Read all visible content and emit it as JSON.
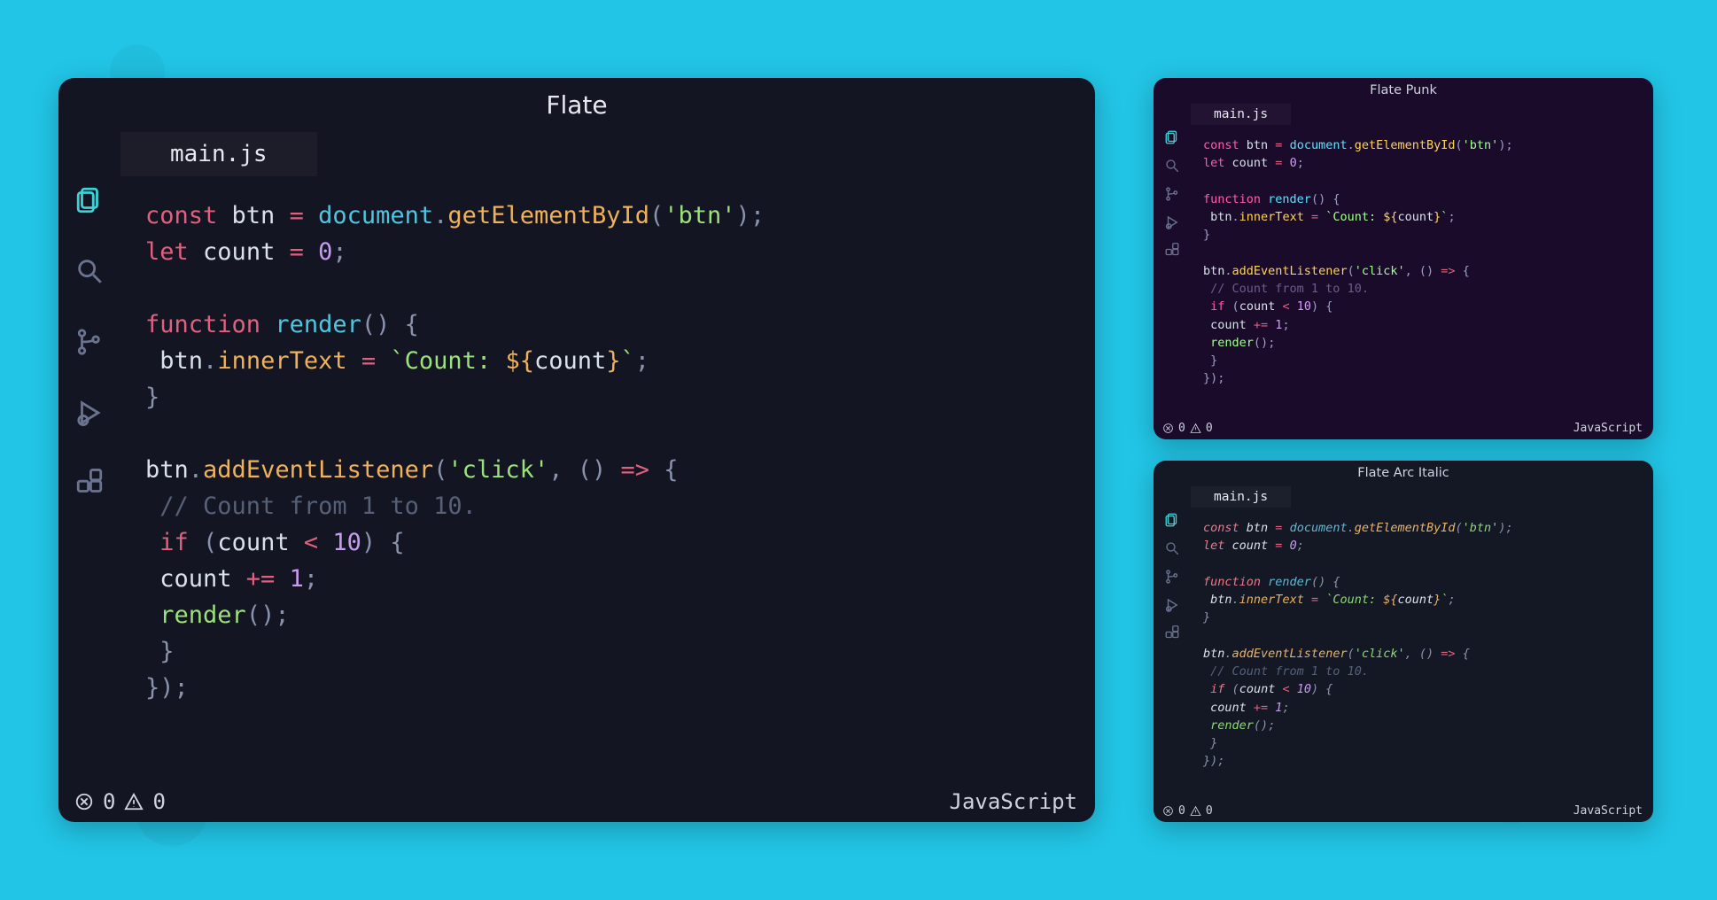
{
  "themes": {
    "main": {
      "title": "Flate",
      "filename": "main.js",
      "errors": "0",
      "warnings": "0",
      "language": "JavaScript"
    },
    "punk": {
      "title": "Flate Punk",
      "filename": "main.js",
      "errors": "0",
      "warnings": "0",
      "language": "JavaScript"
    },
    "arc": {
      "title": "Flate Arc Italic",
      "filename": "main.js",
      "errors": "0",
      "warnings": "0",
      "language": "JavaScript"
    }
  },
  "tokens": {
    "const": "const",
    "let": "let",
    "function": "function",
    "if": "if",
    "btn": "btn",
    "count": "count",
    "document": "document",
    "getElementById": "getElementById",
    "addEventListener": "addEventListener",
    "innerText": "innerText",
    "render": "render",
    "str_btn": "'btn'",
    "str_click": "'click'",
    "tpl_open": "`Count: ",
    "tpl_ipol_open": "${",
    "tpl_ipol_close": "}",
    "tpl_close": "`",
    "eq": " = ",
    "plus_eq": " += ",
    "lt": " < ",
    "arrow": "=>",
    "zero": "0",
    "one": "1",
    "ten": "10",
    "dot": ".",
    "semi": ";",
    "comma": ", ",
    "lp": "(",
    "rp": ")",
    "lb": "{",
    "rb": "}",
    "lprp": "()",
    "cmt": "// Count from 1 to 10."
  },
  "activity_icons": [
    "files",
    "search",
    "git",
    "debug",
    "extensions"
  ]
}
